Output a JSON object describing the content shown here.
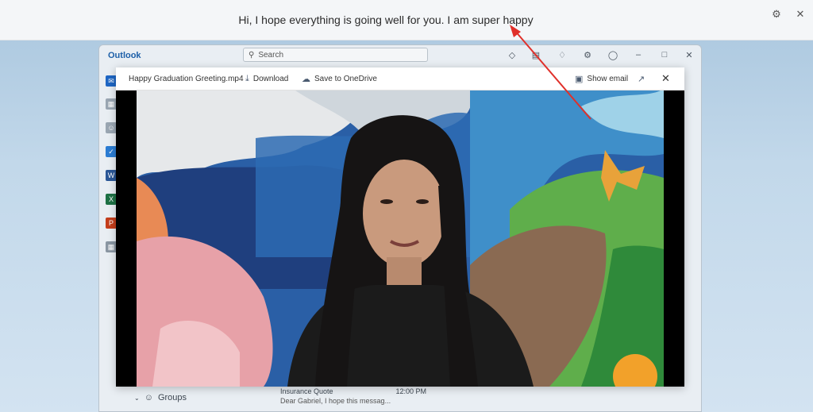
{
  "caption": {
    "text": "Hi, I hope everything is going well for you. I am super happy"
  },
  "outlook": {
    "app_title": "Outlook",
    "search_placeholder": "Search",
    "nav": {
      "groups_label": "Groups"
    },
    "message_preview": {
      "subject": "Insurance Quote",
      "time": "12:00 PM",
      "snippet": "Dear Gabriel, I hope this messag..."
    }
  },
  "viewer": {
    "file_name": "Happy Graduation Greeting.mp4",
    "download_label": "Download",
    "save_label": "Save to OneDrive",
    "show_email_label": "Show email"
  },
  "colors": {
    "outlook_brand": "#1c5fa8",
    "annotation_arrow": "#e0302a"
  }
}
